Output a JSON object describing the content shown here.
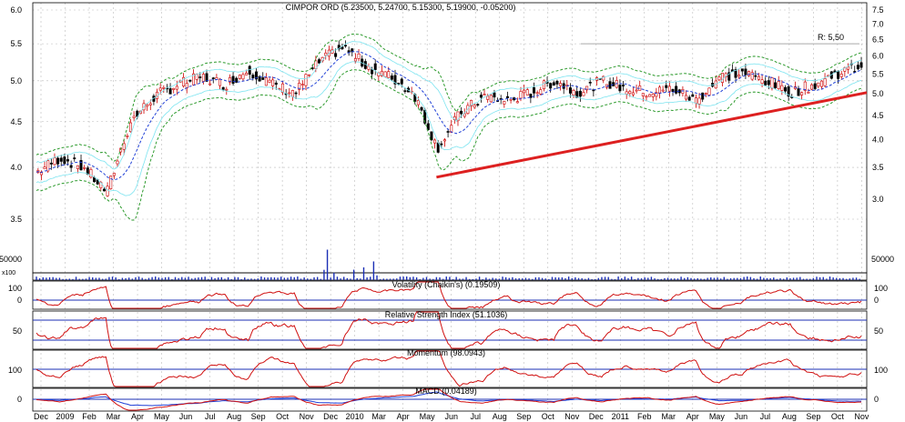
{
  "colors": {
    "background": "#ffffff",
    "candle_up": "#cc0000",
    "candle_down": "#000000",
    "bollinger": "#2e9b2e",
    "moving_average": "#1f3fd6",
    "envelope": "#7ce4f0",
    "trendline": "#dd2020",
    "resistance": "#aaaaaa",
    "volume": "#1b2fb5",
    "indicator": "#d01010",
    "indicator_ref": "#1b2fb5",
    "grid": "#bbbbbb"
  },
  "chart_data": [
    {
      "type": "candlestick",
      "title": "CIMPOR ORD (5.23500, 5.24700, 5.15300, 5.19900, -0.05200)",
      "x_axis_labels": [
        "Dec",
        "2009",
        "Feb",
        "Mar",
        "Apr",
        "May",
        "Jun",
        "Jul",
        "Aug",
        "Sep",
        "Oct",
        "Nov",
        "Dec",
        "2010",
        "Mar",
        "Apr",
        "May",
        "Jun",
        "Jul",
        "Aug",
        "Sep",
        "Oct",
        "Nov",
        "Dec",
        "2011",
        "Feb",
        "Mar",
        "Apr",
        "May",
        "Jun",
        "Jul",
        "Aug",
        "Sep",
        "Oct",
        "Nov"
      ],
      "y_left_ticks": [
        "6.0",
        "5.5",
        "5.0",
        "4.5",
        "4.0",
        "3.5"
      ],
      "y_right_ticks": [
        "7.5",
        "7.0",
        "6.5",
        "6.0",
        "5.5",
        "5.0",
        "4.5",
        "4.0",
        "3.5",
        "3.0"
      ],
      "log_scale": true,
      "grid": true,
      "series": [
        {
          "name": "CIMPOR ORD",
          "x": [
            "2008-12",
            "2009-01",
            "2009-02",
            "2009-03",
            "2009-04",
            "2009-05",
            "2009-06",
            "2009-07",
            "2009-08",
            "2009-09",
            "2009-10",
            "2009-11",
            "2009-12",
            "2010-01",
            "2010-02",
            "2010-03",
            "2010-04",
            "2010-05",
            "2010-06",
            "2010-07",
            "2010-08",
            "2010-09",
            "2010-10",
            "2010-11",
            "2010-12",
            "2011-01",
            "2011-02",
            "2011-03",
            "2011-04",
            "2011-05",
            "2011-06",
            "2011-07",
            "2011-08",
            "2011-09",
            "2011-10",
            "2011-11"
          ],
          "close": [
            3.95,
            4.1,
            4.0,
            3.75,
            4.5,
            4.8,
            4.95,
            5.05,
            4.95,
            5.15,
            4.95,
            4.85,
            5.25,
            5.45,
            5.2,
            5.05,
            4.85,
            4.2,
            4.6,
            4.8,
            4.75,
            4.85,
            5.0,
            4.85,
            5.0,
            4.9,
            4.85,
            4.9,
            4.75,
            5.05,
            5.1,
            5.0,
            4.85,
            4.95,
            5.1,
            5.2
          ]
        }
      ],
      "annotations": [
        {
          "text": "R: 5,50",
          "y": 5.5
        },
        {
          "text": "trendline",
          "x_from": "2010-05",
          "y_from": 3.9,
          "x_to": "2011-11",
          "y_to": 4.85
        }
      ]
    },
    {
      "type": "bar",
      "title": "Volume",
      "y_ticks": [
        "50000"
      ],
      "scale_label": "x100"
    },
    {
      "type": "line",
      "title": "Volatility (Chaikin's) (0.19509)",
      "y_ticks": [
        "100",
        "0"
      ],
      "reference": 0
    },
    {
      "type": "line",
      "title": "Relative Strength Index (51.1036)",
      "y_ticks": [
        "50"
      ],
      "reference": [
        70,
        30
      ]
    },
    {
      "type": "line",
      "title": "Momentum (98.0943)",
      "y_ticks": [
        "100"
      ],
      "reference": 100
    },
    {
      "type": "line",
      "title": "MACD (0.04189)",
      "y_ticks": [
        "0"
      ],
      "reference": 0
    }
  ]
}
